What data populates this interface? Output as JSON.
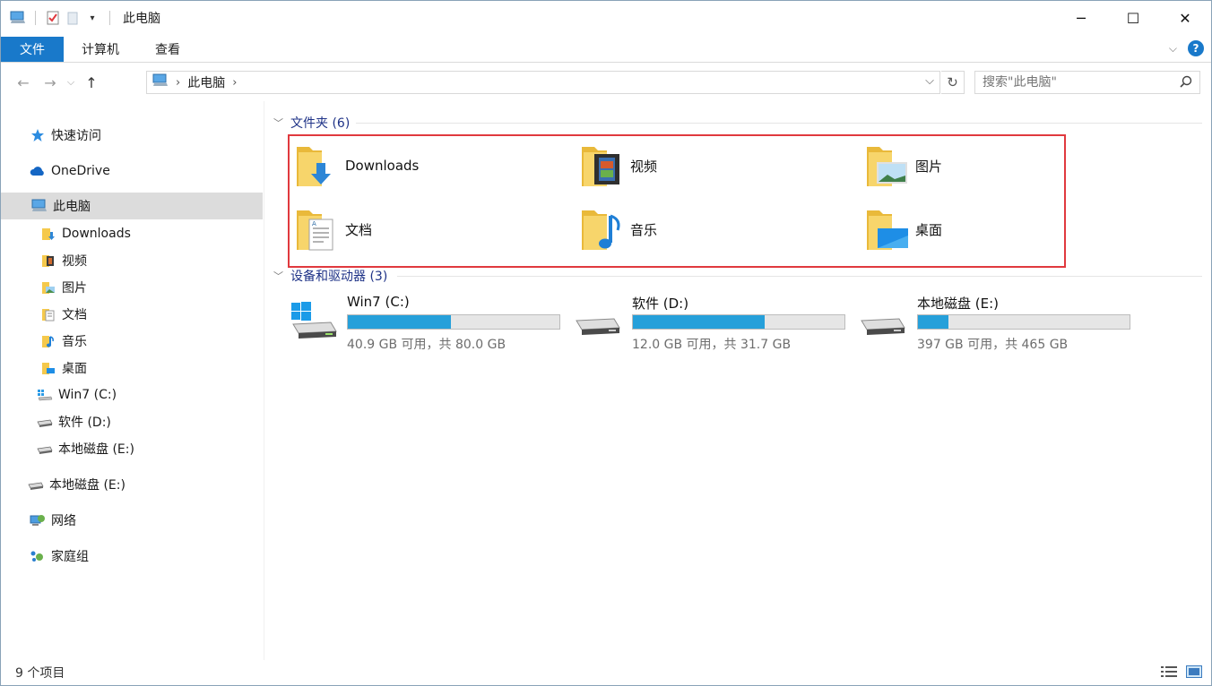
{
  "window": {
    "title": "此电脑",
    "controls": {
      "minimize": "─",
      "maximize": "☐",
      "close": "✕"
    }
  },
  "ribbon": {
    "tabs": [
      "文件",
      "计算机",
      "查看"
    ]
  },
  "address": {
    "crumbs": [
      "此电脑"
    ],
    "search_placeholder": "搜索\"此电脑\""
  },
  "sidebar": {
    "items": [
      {
        "label": "快速访问",
        "icon": "star-icon"
      },
      {
        "label": "OneDrive",
        "icon": "cloud-icon"
      },
      {
        "label": "此电脑",
        "icon": "computer-icon",
        "selected": true
      },
      {
        "label": "Downloads",
        "icon": "downloads-folder-icon"
      },
      {
        "label": "视频",
        "icon": "video-folder-icon"
      },
      {
        "label": "图片",
        "icon": "pictures-folder-icon"
      },
      {
        "label": "文档",
        "icon": "documents-folder-icon"
      },
      {
        "label": "音乐",
        "icon": "music-folder-icon"
      },
      {
        "label": "桌面",
        "icon": "desktop-folder-icon"
      },
      {
        "label": "Win7 (C:)",
        "icon": "windows-drive-icon"
      },
      {
        "label": "软件 (D:)",
        "icon": "drive-icon"
      },
      {
        "label": "本地磁盘 (E:)",
        "icon": "drive-icon"
      },
      {
        "label": "本地磁盘 (E:)",
        "icon": "drive-icon"
      },
      {
        "label": "网络",
        "icon": "network-icon"
      },
      {
        "label": "家庭组",
        "icon": "homegroup-icon"
      }
    ]
  },
  "folders_group": {
    "header": "文件夹 (6)",
    "items": [
      {
        "label": "Downloads",
        "icon": "downloads-folder-icon"
      },
      {
        "label": "视频",
        "icon": "video-folder-icon"
      },
      {
        "label": "图片",
        "icon": "pictures-folder-icon"
      },
      {
        "label": "文档",
        "icon": "documents-folder-icon"
      },
      {
        "label": "音乐",
        "icon": "music-folder-icon"
      },
      {
        "label": "桌面",
        "icon": "desktop-folder-icon"
      }
    ]
  },
  "drives_group": {
    "header": "设备和驱动器 (3)",
    "items": [
      {
        "label": "Win7 (C:)",
        "free_text": "40.9 GB 可用，共 80.0 GB",
        "used_fraction": 0.489,
        "icon": "windows-drive-icon"
      },
      {
        "label": "软件 (D:)",
        "free_text": "12.0 GB 可用，共 31.7 GB",
        "used_fraction": 0.621,
        "icon": "drive-icon"
      },
      {
        "label": "本地磁盘 (E:)",
        "free_text": "397 GB 可用，共 465 GB",
        "used_fraction": 0.146,
        "icon": "drive-icon"
      }
    ]
  },
  "status": {
    "item_count": "9 个项目"
  },
  "colors": {
    "accent": "#1979ca",
    "bar_fill": "#26a0da",
    "highlight_border": "#e0393e",
    "group_header": "#1e3287"
  }
}
